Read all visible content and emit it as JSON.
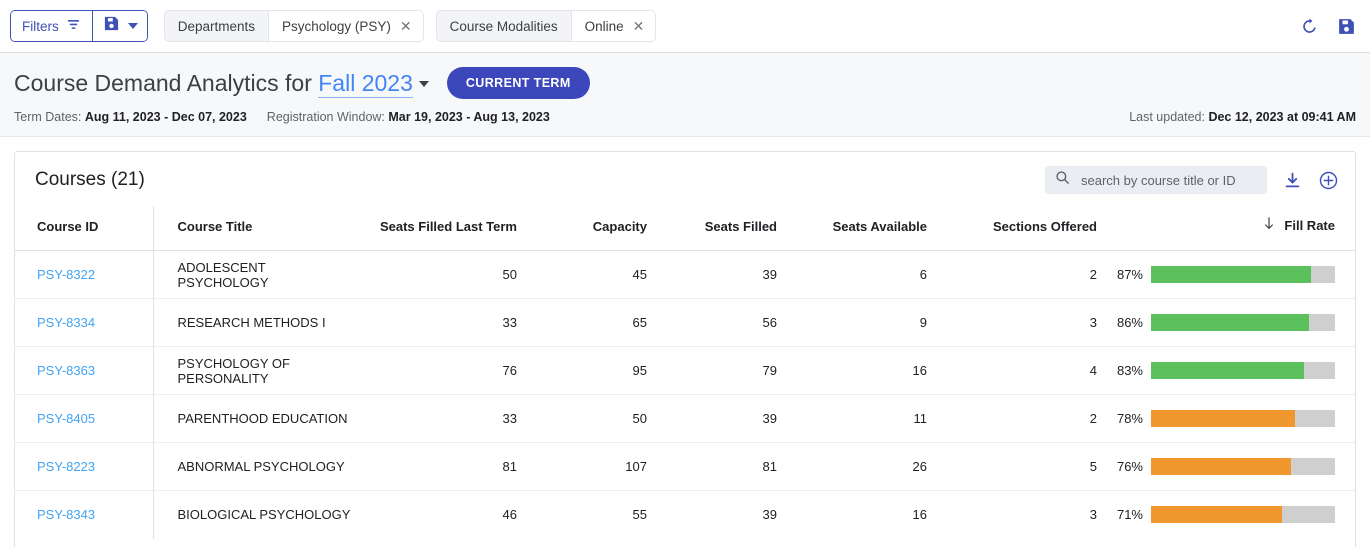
{
  "toolbar": {
    "filters_label": "Filters",
    "filter_icon": "filter-funnel-icon",
    "save_icon": "save-floppy-icon",
    "dropdown_icon": "chevron-down-icon",
    "refresh_icon": "refresh-icon",
    "save_right_icon": "save-floppy-icon",
    "chip_groups": [
      {
        "label": "Departments",
        "value": "Psychology (PSY)",
        "remove_icon": "close-icon"
      },
      {
        "label": "Course Modalities",
        "value": "Online",
        "remove_icon": "close-icon"
      }
    ]
  },
  "header": {
    "title_prefix": "Course Demand Analytics for",
    "term": "Fall 2023",
    "current_term_button": "CURRENT TERM",
    "term_dates_label": "Term Dates:",
    "term_dates_value": "Aug 11, 2023 - Dec 07, 2023",
    "registration_label": "Registration Window:",
    "registration_value": "Mar 19, 2023 - Aug 13, 2023",
    "last_updated_label": "Last updated:",
    "last_updated_value": "Dec 12, 2023 at 09:41 AM"
  },
  "card": {
    "title": "Courses (21)",
    "search_placeholder": "search by course title or ID",
    "search_value": "",
    "search_icon": "search-icon",
    "download_icon": "download-icon",
    "add_icon": "add-circle-icon"
  },
  "table": {
    "columns": [
      "Course ID",
      "Course Title",
      "Seats Filled Last Term",
      "Capacity",
      "Seats Filled",
      "Seats Available",
      "Sections Offered",
      "Fill Rate"
    ],
    "sort": {
      "column": "Fill Rate",
      "direction": "desc",
      "icon": "arrow-down-icon"
    },
    "rows": [
      {
        "course_id": "PSY-8322",
        "course_title": "ADOLESCENT PSYCHOLOGY",
        "seats_filled_last_term": "50",
        "capacity": "45",
        "seats_filled": "39",
        "seats_available": "6",
        "sections_offered": "2",
        "fill_rate_label": "87%",
        "fill_rate_pct": 87,
        "fill_rate_color": "#5cc05c"
      },
      {
        "course_id": "PSY-8334",
        "course_title": "RESEARCH METHODS I",
        "seats_filled_last_term": "33",
        "capacity": "65",
        "seats_filled": "56",
        "seats_available": "9",
        "sections_offered": "3",
        "fill_rate_label": "86%",
        "fill_rate_pct": 86,
        "fill_rate_color": "#5cc05c"
      },
      {
        "course_id": "PSY-8363",
        "course_title": "PSYCHOLOGY OF PERSONALITY",
        "seats_filled_last_term": "76",
        "capacity": "95",
        "seats_filled": "79",
        "seats_available": "16",
        "sections_offered": "4",
        "fill_rate_label": "83%",
        "fill_rate_pct": 83,
        "fill_rate_color": "#5cc05c"
      },
      {
        "course_id": "PSY-8405",
        "course_title": "PARENTHOOD EDUCATION",
        "seats_filled_last_term": "33",
        "capacity": "50",
        "seats_filled": "39",
        "seats_available": "11",
        "sections_offered": "2",
        "fill_rate_label": "78%",
        "fill_rate_pct": 78,
        "fill_rate_color": "#f0982d"
      },
      {
        "course_id": "PSY-8223",
        "course_title": "ABNORMAL PSYCHOLOGY",
        "seats_filled_last_term": "81",
        "capacity": "107",
        "seats_filled": "81",
        "seats_available": "26",
        "sections_offered": "5",
        "fill_rate_label": "76%",
        "fill_rate_pct": 76,
        "fill_rate_color": "#f0982d"
      },
      {
        "course_id": "PSY-8343",
        "course_title": "BIOLOGICAL PSYCHOLOGY",
        "seats_filled_last_term": "46",
        "capacity": "55",
        "seats_filled": "39",
        "seats_available": "16",
        "sections_offered": "3",
        "fill_rate_label": "71%",
        "fill_rate_pct": 71,
        "fill_rate_color": "#f0982d"
      }
    ]
  },
  "colors": {
    "primary": "#3f51b5",
    "accent_button": "#3b47ba",
    "link": "#42a5f5",
    "term_link": "#4285f4",
    "bar_good": "#5cc05c",
    "bar_warn": "#f0982d",
    "bar_track": "#cfcfcf"
  }
}
